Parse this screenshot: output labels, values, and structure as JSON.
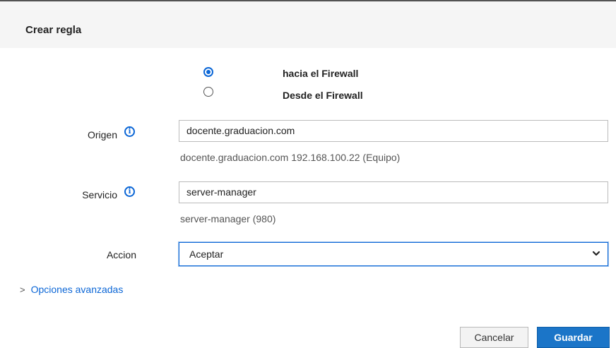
{
  "dialog": {
    "title": "Crear regla"
  },
  "direction": {
    "options": [
      {
        "label": "hacia el Firewall",
        "checked": true
      },
      {
        "label": "Desde el Firewall",
        "checked": false
      }
    ]
  },
  "form": {
    "origin": {
      "label": "Origen",
      "value": "docente.graduacion.com",
      "helper": "docente.graduacion.com 192.168.100.22 (Equipo)"
    },
    "service": {
      "label": "Servicio",
      "value": "server-manager",
      "helper": "server-manager (980)"
    },
    "action": {
      "label": "Accion",
      "selected": "Aceptar"
    }
  },
  "advanced_link": "Opciones avanzadas",
  "buttons": {
    "cancel": "Cancelar",
    "save": "Guardar"
  },
  "icons": {
    "info": "info-icon",
    "chevron": "chevron-down-icon",
    "expand": "chevron-right-icon"
  },
  "colors": {
    "accent": "#0b66d6",
    "primary_button": "#1b75c8",
    "header_bg": "#f5f5f5"
  }
}
